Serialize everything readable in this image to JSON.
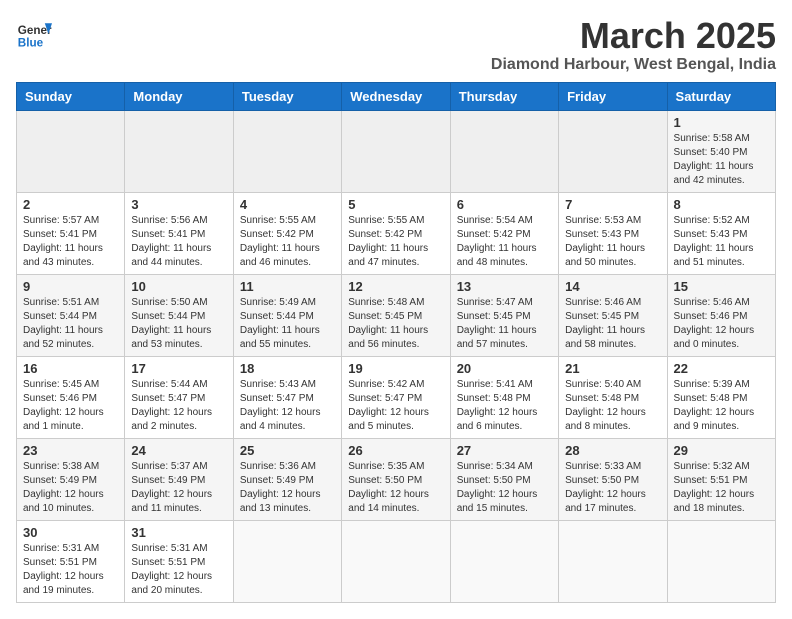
{
  "logo": {
    "line1": "General",
    "line2": "Blue"
  },
  "title": "March 2025",
  "location": "Diamond Harbour, West Bengal, India",
  "weekdays": [
    "Sunday",
    "Monday",
    "Tuesday",
    "Wednesday",
    "Thursday",
    "Friday",
    "Saturday"
  ],
  "weeks": [
    [
      {
        "day": "",
        "info": ""
      },
      {
        "day": "",
        "info": ""
      },
      {
        "day": "",
        "info": ""
      },
      {
        "day": "",
        "info": ""
      },
      {
        "day": "",
        "info": ""
      },
      {
        "day": "",
        "info": ""
      },
      {
        "day": "1",
        "info": "Sunrise: 5:58 AM\nSunset: 5:40 PM\nDaylight: 11 hours and 42 minutes."
      }
    ],
    [
      {
        "day": "2",
        "info": "Sunrise: 5:57 AM\nSunset: 5:41 PM\nDaylight: 11 hours and 43 minutes."
      },
      {
        "day": "3",
        "info": "Sunrise: 5:56 AM\nSunset: 5:41 PM\nDaylight: 11 hours and 44 minutes."
      },
      {
        "day": "4",
        "info": "Sunrise: 5:55 AM\nSunset: 5:42 PM\nDaylight: 11 hours and 46 minutes."
      },
      {
        "day": "5",
        "info": "Sunrise: 5:55 AM\nSunset: 5:42 PM\nDaylight: 11 hours and 47 minutes."
      },
      {
        "day": "6",
        "info": "Sunrise: 5:54 AM\nSunset: 5:42 PM\nDaylight: 11 hours and 48 minutes."
      },
      {
        "day": "7",
        "info": "Sunrise: 5:53 AM\nSunset: 5:43 PM\nDaylight: 11 hours and 50 minutes."
      },
      {
        "day": "8",
        "info": "Sunrise: 5:52 AM\nSunset: 5:43 PM\nDaylight: 11 hours and 51 minutes."
      }
    ],
    [
      {
        "day": "9",
        "info": "Sunrise: 5:51 AM\nSunset: 5:44 PM\nDaylight: 11 hours and 52 minutes."
      },
      {
        "day": "10",
        "info": "Sunrise: 5:50 AM\nSunset: 5:44 PM\nDaylight: 11 hours and 53 minutes."
      },
      {
        "day": "11",
        "info": "Sunrise: 5:49 AM\nSunset: 5:44 PM\nDaylight: 11 hours and 55 minutes."
      },
      {
        "day": "12",
        "info": "Sunrise: 5:48 AM\nSunset: 5:45 PM\nDaylight: 11 hours and 56 minutes."
      },
      {
        "day": "13",
        "info": "Sunrise: 5:47 AM\nSunset: 5:45 PM\nDaylight: 11 hours and 57 minutes."
      },
      {
        "day": "14",
        "info": "Sunrise: 5:46 AM\nSunset: 5:45 PM\nDaylight: 11 hours and 58 minutes."
      },
      {
        "day": "15",
        "info": "Sunrise: 5:46 AM\nSunset: 5:46 PM\nDaylight: 12 hours and 0 minutes."
      }
    ],
    [
      {
        "day": "16",
        "info": "Sunrise: 5:45 AM\nSunset: 5:46 PM\nDaylight: 12 hours and 1 minute."
      },
      {
        "day": "17",
        "info": "Sunrise: 5:44 AM\nSunset: 5:47 PM\nDaylight: 12 hours and 2 minutes."
      },
      {
        "day": "18",
        "info": "Sunrise: 5:43 AM\nSunset: 5:47 PM\nDaylight: 12 hours and 4 minutes."
      },
      {
        "day": "19",
        "info": "Sunrise: 5:42 AM\nSunset: 5:47 PM\nDaylight: 12 hours and 5 minutes."
      },
      {
        "day": "20",
        "info": "Sunrise: 5:41 AM\nSunset: 5:48 PM\nDaylight: 12 hours and 6 minutes."
      },
      {
        "day": "21",
        "info": "Sunrise: 5:40 AM\nSunset: 5:48 PM\nDaylight: 12 hours and 8 minutes."
      },
      {
        "day": "22",
        "info": "Sunrise: 5:39 AM\nSunset: 5:48 PM\nDaylight: 12 hours and 9 minutes."
      }
    ],
    [
      {
        "day": "23",
        "info": "Sunrise: 5:38 AM\nSunset: 5:49 PM\nDaylight: 12 hours and 10 minutes."
      },
      {
        "day": "24",
        "info": "Sunrise: 5:37 AM\nSunset: 5:49 PM\nDaylight: 12 hours and 11 minutes."
      },
      {
        "day": "25",
        "info": "Sunrise: 5:36 AM\nSunset: 5:49 PM\nDaylight: 12 hours and 13 minutes."
      },
      {
        "day": "26",
        "info": "Sunrise: 5:35 AM\nSunset: 5:50 PM\nDaylight: 12 hours and 14 minutes."
      },
      {
        "day": "27",
        "info": "Sunrise: 5:34 AM\nSunset: 5:50 PM\nDaylight: 12 hours and 15 minutes."
      },
      {
        "day": "28",
        "info": "Sunrise: 5:33 AM\nSunset: 5:50 PM\nDaylight: 12 hours and 17 minutes."
      },
      {
        "day": "29",
        "info": "Sunrise: 5:32 AM\nSunset: 5:51 PM\nDaylight: 12 hours and 18 minutes."
      }
    ],
    [
      {
        "day": "30",
        "info": "Sunrise: 5:31 AM\nSunset: 5:51 PM\nDaylight: 12 hours and 19 minutes."
      },
      {
        "day": "31",
        "info": "Sunrise: 5:31 AM\nSunset: 5:51 PM\nDaylight: 12 hours and 20 minutes."
      },
      {
        "day": "",
        "info": ""
      },
      {
        "day": "",
        "info": ""
      },
      {
        "day": "",
        "info": ""
      },
      {
        "day": "",
        "info": ""
      },
      {
        "day": "",
        "info": ""
      }
    ]
  ]
}
